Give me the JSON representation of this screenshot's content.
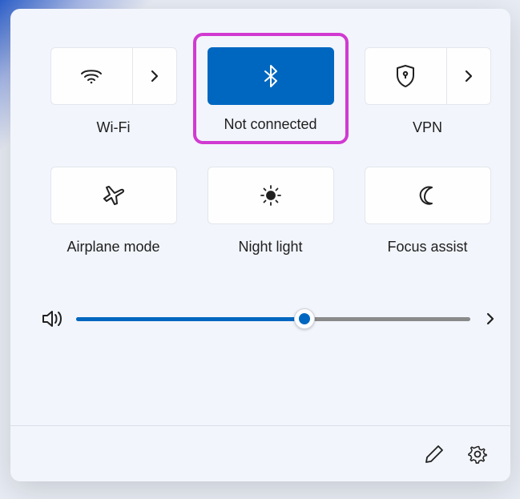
{
  "tiles": {
    "wifi": {
      "label": "Wi-Fi",
      "active": false
    },
    "bluetooth": {
      "label": "Not connected",
      "active": true,
      "highlighted": true
    },
    "vpn": {
      "label": "VPN",
      "active": false
    },
    "airplane": {
      "label": "Airplane mode",
      "active": false
    },
    "nightlight": {
      "label": "Night light",
      "active": false
    },
    "focus": {
      "label": "Focus assist",
      "active": false
    }
  },
  "volume": {
    "percent": 58
  },
  "colors": {
    "accent": "#0067c0",
    "highlight": "#d13ad1"
  }
}
